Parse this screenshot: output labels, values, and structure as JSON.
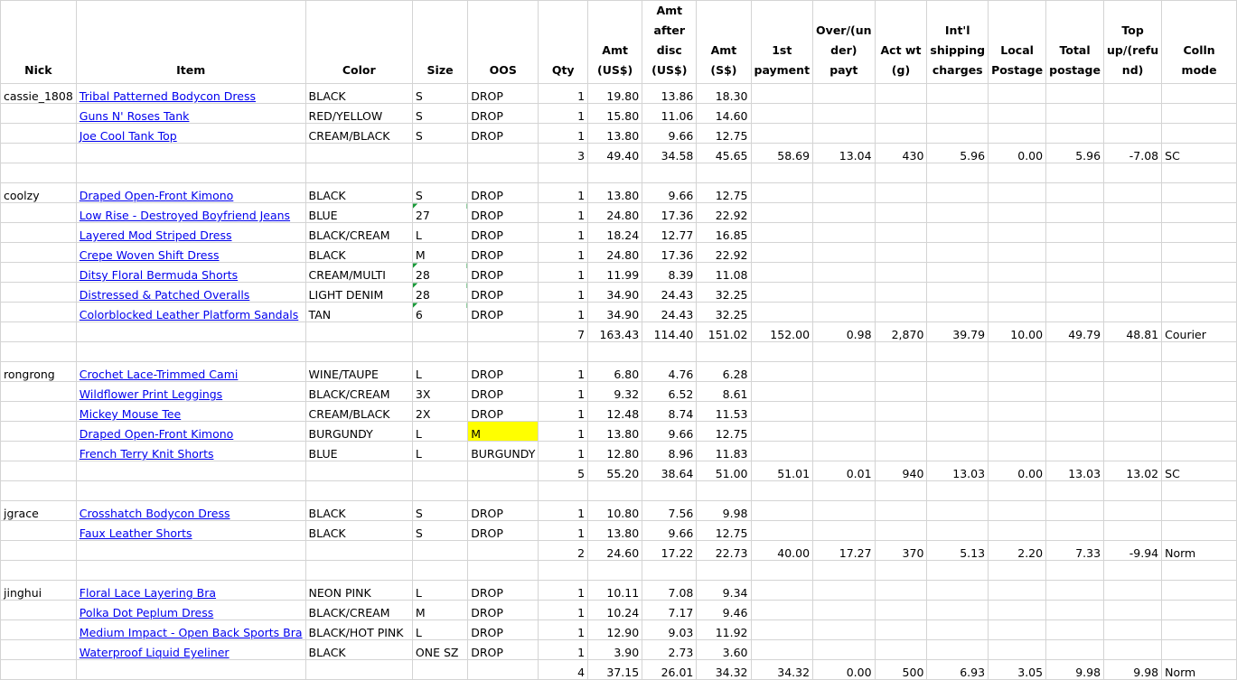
{
  "headers": {
    "nick": "Nick",
    "item": "Item",
    "color": "Color",
    "size": "Size",
    "oos": "OOS",
    "qty": "Qty",
    "amt_usd": [
      "Amt",
      "(US$)"
    ],
    "amt_after_disc": [
      "Amt",
      "after",
      "disc",
      "(US$)"
    ],
    "amt_sgd": [
      "Amt (S$)"
    ],
    "first_payment": [
      "1st",
      "payment"
    ],
    "over_under": [
      "Over/(un",
      "der) payt"
    ],
    "act_wt": [
      "Act wt",
      "(g)"
    ],
    "intl_shipping": [
      "Int'l",
      "shipping",
      "charges"
    ],
    "local_postage": [
      "Local",
      "Postage"
    ],
    "total_postage": [
      "Total",
      "postage"
    ],
    "top_up": [
      "Top",
      "up/(refu",
      "nd)"
    ],
    "colln_mode": "Colln mode"
  },
  "groups": [
    {
      "nick": "cassie_1808",
      "items": [
        {
          "item": "Tribal Patterned Bodycon Dress",
          "color": "BLACK",
          "size": "S",
          "oos": "DROP",
          "qty": "1",
          "amt": "19.80",
          "disc": "13.86",
          "sgd": "18.30"
        },
        {
          "item": "Guns N' Roses Tank",
          "color": "RED/YELLOW",
          "size": "S",
          "oos": "DROP",
          "qty": "1",
          "amt": "15.80",
          "disc": "11.06",
          "sgd": "14.60"
        },
        {
          "item": "Joe Cool Tank Top",
          "color": "CREAM/BLACK",
          "size": "S",
          "oos": "DROP",
          "qty": "1",
          "amt": "13.80",
          "disc": "9.66",
          "sgd": "12.75"
        }
      ],
      "total": {
        "qty": "3",
        "amt": "49.40",
        "disc": "34.58",
        "sgd": "45.65",
        "first": "58.69",
        "over": "13.04",
        "wt": "430",
        "intl": "5.96",
        "local": "0.00",
        "postage": "5.96",
        "topup": "-7.08",
        "mode": "SC"
      }
    },
    {
      "nick": "coolzy",
      "items": [
        {
          "item": "Draped Open-Front Kimono",
          "color": "BLACK",
          "size": "S",
          "oos": "DROP",
          "qty": "1",
          "amt": "13.80",
          "disc": "9.66",
          "sgd": "12.75"
        },
        {
          "item": "Low Rise - Destroyed Boyfriend Jeans",
          "color": "BLUE",
          "size": "27",
          "oos": "DROP",
          "qty": "1",
          "amt": "24.80",
          "disc": "17.36",
          "sgd": "22.92",
          "flag": true
        },
        {
          "item": "Layered Mod Striped Dress",
          "color": "BLACK/CREAM",
          "size": "L",
          "oos": "DROP",
          "qty": "1",
          "amt": "18.24",
          "disc": "12.77",
          "sgd": "16.85"
        },
        {
          "item": "Crepe Woven Shift Dress",
          "color": "BLACK",
          "size": "M",
          "oos": "DROP",
          "qty": "1",
          "amt": "24.80",
          "disc": "17.36",
          "sgd": "22.92"
        },
        {
          "item": "Ditsy Floral Bermuda Shorts",
          "color": "CREAM/MULTI",
          "size": "28",
          "oos": "DROP",
          "qty": "1",
          "amt": "11.99",
          "disc": "8.39",
          "sgd": "11.08",
          "flag": true
        },
        {
          "item": "Distressed & Patched Overalls",
          "color": "LIGHT DENIM",
          "size": "28",
          "oos": "DROP",
          "qty": "1",
          "amt": "34.90",
          "disc": "24.43",
          "sgd": "32.25",
          "flag": true
        },
        {
          "item": "Colorblocked Leather Platform Sandals",
          "color": "TAN",
          "size": "6",
          "oos": "DROP",
          "qty": "1",
          "amt": "34.90",
          "disc": "24.43",
          "sgd": "32.25",
          "flag": true
        }
      ],
      "total": {
        "qty": "7",
        "amt": "163.43",
        "disc": "114.40",
        "sgd": "151.02",
        "first": "152.00",
        "over": "0.98",
        "wt": "2,870",
        "intl": "39.79",
        "local": "10.00",
        "postage": "49.79",
        "topup": "48.81",
        "mode": "Courier"
      }
    },
    {
      "nick": "rongrong",
      "items": [
        {
          "item": "Crochet Lace-Trimmed Cami",
          "color": "WINE/TAUPE",
          "size": "L",
          "oos": "DROP",
          "qty": "1",
          "amt": "6.80",
          "disc": "4.76",
          "sgd": "6.28"
        },
        {
          "item": "Wildflower Print Leggings",
          "color": "BLACK/CREAM",
          "size": "3X",
          "oos": "DROP",
          "qty": "1",
          "amt": "9.32",
          "disc": "6.52",
          "sgd": "8.61"
        },
        {
          "item": "Mickey Mouse Tee",
          "color": "CREAM/BLACK",
          "size": "2X",
          "oos": "DROP",
          "qty": "1",
          "amt": "12.48",
          "disc": "8.74",
          "sgd": "11.53"
        },
        {
          "item": "Draped Open-Front Kimono",
          "color": "BURGUNDY",
          "size": "L",
          "oos": "M",
          "qty": "1",
          "amt": "13.80",
          "disc": "9.66",
          "sgd": "12.75",
          "highlight": true
        },
        {
          "item": "French Terry Knit Shorts",
          "color": "BLUE",
          "size": "L",
          "oos": "BURGUNDY",
          "qty": "1",
          "amt": "12.80",
          "disc": "8.96",
          "sgd": "11.83"
        }
      ],
      "total": {
        "qty": "5",
        "amt": "55.20",
        "disc": "38.64",
        "sgd": "51.00",
        "first": "51.01",
        "over": "0.01",
        "wt": "940",
        "intl": "13.03",
        "local": "0.00",
        "postage": "13.03",
        "topup": "13.02",
        "mode": "SC"
      }
    },
    {
      "nick": "jgrace",
      "items": [
        {
          "item": "Crosshatch Bodycon Dress",
          "color": "BLACK",
          "size": "S",
          "oos": "DROP",
          "qty": "1",
          "amt": "10.80",
          "disc": "7.56",
          "sgd": "9.98"
        },
        {
          "item": "Faux Leather Shorts",
          "color": "BLACK",
          "size": "S",
          "oos": "DROP",
          "qty": "1",
          "amt": "13.80",
          "disc": "9.66",
          "sgd": "12.75"
        }
      ],
      "total": {
        "qty": "2",
        "amt": "24.60",
        "disc": "17.22",
        "sgd": "22.73",
        "first": "40.00",
        "over": "17.27",
        "wt": "370",
        "intl": "5.13",
        "local": "2.20",
        "postage": "7.33",
        "topup": "-9.94",
        "mode": "Norm"
      }
    },
    {
      "nick": "jinghui",
      "items": [
        {
          "item": "Floral Lace Layering Bra",
          "color": "NEON PINK",
          "size": "L",
          "oos": "DROP",
          "qty": "1",
          "amt": "10.11",
          "disc": "7.08",
          "sgd": "9.34"
        },
        {
          "item": "Polka Dot Peplum Dress",
          "color": "BLACK/CREAM",
          "size": "M",
          "oos": "DROP",
          "qty": "1",
          "amt": "10.24",
          "disc": "7.17",
          "sgd": "9.46"
        },
        {
          "item": "Medium Impact - Open Back Sports Bra",
          "color": "BLACK/HOT PINK",
          "size": "L",
          "oos": "DROP",
          "qty": "1",
          "amt": "12.90",
          "disc": "9.03",
          "sgd": "11.92"
        },
        {
          "item": "Waterproof Liquid Eyeliner",
          "color": "BLACK",
          "size": "ONE SZ",
          "oos": "DROP",
          "qty": "1",
          "amt": "3.90",
          "disc": "2.73",
          "sgd": "3.60"
        }
      ],
      "total": {
        "qty": "4",
        "amt": "37.15",
        "disc": "26.01",
        "sgd": "34.32",
        "first": "34.32",
        "over": "0.00",
        "wt": "500",
        "intl": "6.93",
        "local": "3.05",
        "postage": "9.98",
        "topup": "9.98",
        "mode": "Norm"
      }
    }
  ]
}
